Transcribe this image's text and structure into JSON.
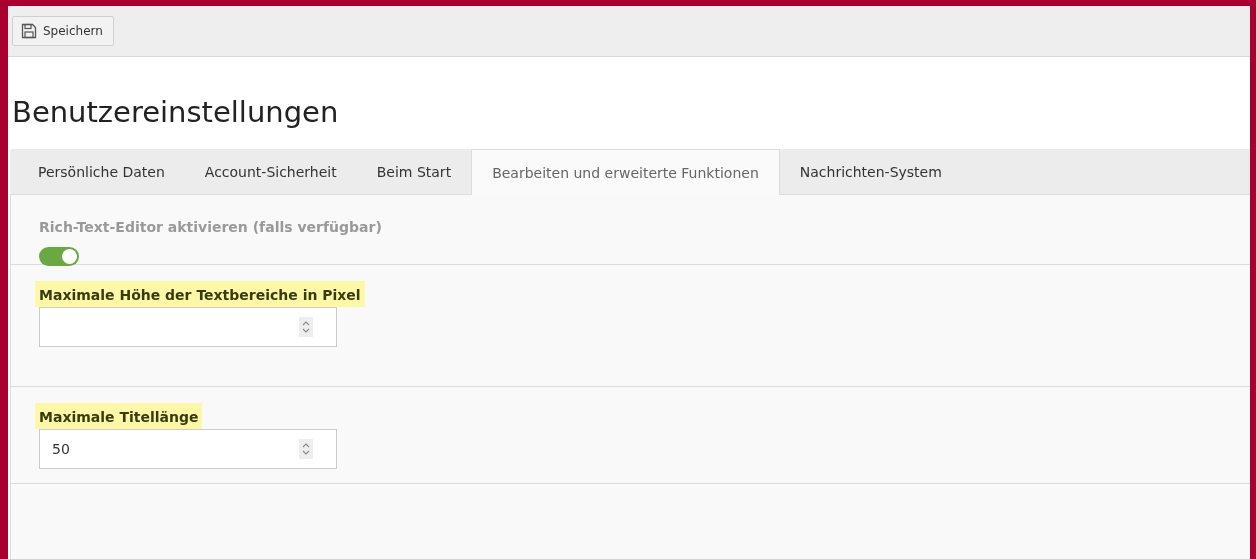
{
  "toolbar": {
    "save_button": "Speichern"
  },
  "title": "Benutzereinstellungen",
  "tabs": [
    {
      "label": "Persönliche Daten",
      "selected": false
    },
    {
      "label": "Account-Sicherheit",
      "selected": false
    },
    {
      "label": "Beim Start",
      "selected": false
    },
    {
      "label": "Bearbeiten und erweiterte Funktionen",
      "selected": true
    },
    {
      "label": "Nachrichten-System",
      "selected": false
    }
  ],
  "settings": [
    {
      "kind": "toggle",
      "label": "Rich-Text-Editor aktivieren (falls verfügbar)",
      "on": true,
      "disabled": true,
      "highlighted": false
    },
    {
      "kind": "number",
      "label": "Maximale Höhe der Textbereiche in Pixel",
      "highlighted": true
    },
    {
      "kind": "number",
      "label": "Maximale Titellänge",
      "value": "50",
      "highlighted": true
    }
  ]
}
